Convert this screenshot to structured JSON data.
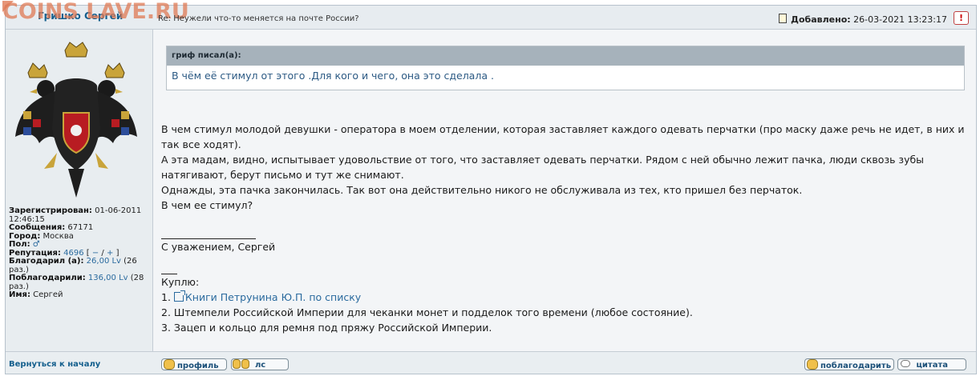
{
  "watermark": "COINS LAVE.RU",
  "header": {
    "author": "Гришко Сергей",
    "subject": "Re: Неужели что-то меняется на почте России?",
    "added_label": "Добавлено:",
    "added_value": "26-03-2021 13:23:17",
    "report_label": "!"
  },
  "profile": {
    "registered_label": "Зарегистрирован:",
    "registered_value": "01-06-2011 12:46:15",
    "messages_label": "Сообщения:",
    "messages_value": "67171",
    "city_label": "Город:",
    "city_value": "Москва",
    "gender_label": "Пол:",
    "gender_value": "♂",
    "reputation_label": "Репутация:",
    "reputation_value": "4696",
    "rep_open": "[",
    "rep_minus": "−",
    "rep_sep": "/",
    "rep_plus": "+",
    "rep_close": "]",
    "thanked_label": "Благодарил (а):",
    "thanked_value": "26,00 Lv",
    "thanked_count": "(26 раз.)",
    "thanks_received_label": "Поблагодарили:",
    "thanks_received_value": "136,00 Lv",
    "thanks_received_count": "(28 раз.)",
    "name_label": "Имя:",
    "name_value": "Сергей"
  },
  "quote": {
    "author_line": "гриф писал(а):",
    "text": "В чём её стимул от этого .Для кого и чего, она это сделала ."
  },
  "post": {
    "p1": "В чем стимул молодой девушки - оператора в моем отделении, которая заставляет каждого одевать перчатки (про маску даже речь не идет, в них и так все ходят).",
    "p2": "А эта мадам, видно, испытывает удовольствие от того, что заставляет одевать перчатки. Рядом с ней обычно лежит пачка, люди сквозь зубы натягивают, берут письмо и тут же снимают.",
    "p3": "Однажды, эта пачка закончилась. Так вот она действительно никого не обслуживала из тех, кто пришел без перчаток.",
    "p4": "В чем ее стимул?",
    "signature": "С уважением, Сергей",
    "buy_title": "Куплю:",
    "item1_num": "1.",
    "item1_link": "Книги Петрунина Ю.П. по списку",
    "item2": "2. Штемпели Российской Империи для чеканки монет и подделок того времени (любое состояние).",
    "item3": "3. Зацеп и кольцо для ремня под пряжу Российской Империи."
  },
  "footer": {
    "back_to_top": "Вернуться к началу",
    "profile_btn": "профиль",
    "pm_btn": "лс",
    "thank_btn": "поблагодарить",
    "quote_btn": "цитата"
  }
}
